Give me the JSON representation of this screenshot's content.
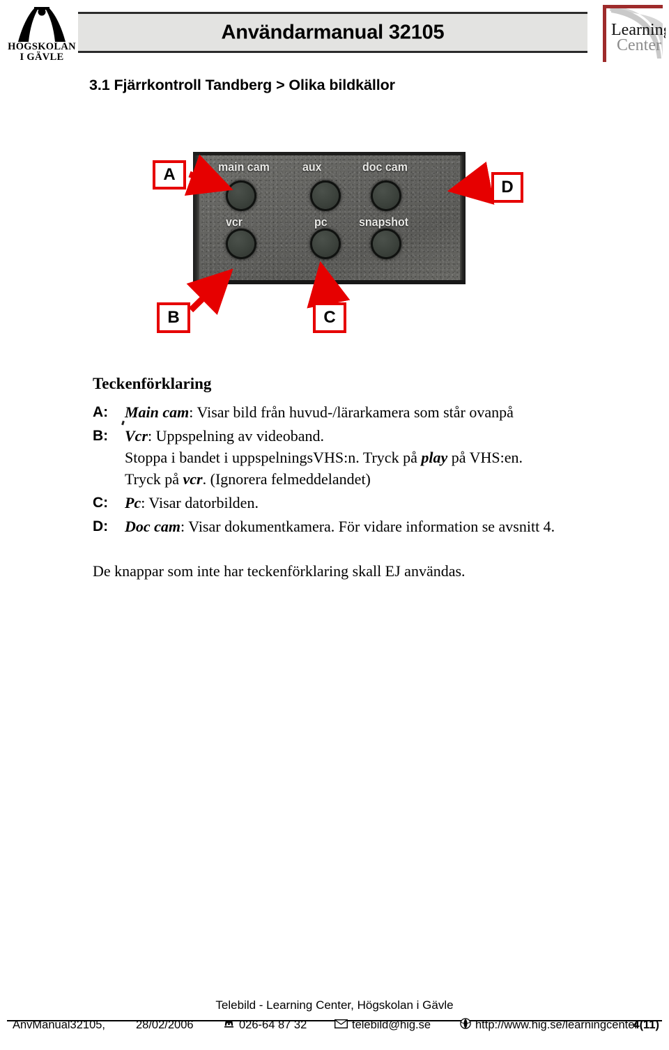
{
  "header": {
    "university_logo_line1": "HÖGSKOLAN",
    "university_logo_line2": "I GÄVLE",
    "title": "Användarmanual 32105",
    "partner_logo_line1": "Learning",
    "partner_logo_line2": "Center",
    "accent_red": "#9e2b2b",
    "bar_background": "#e3e3e1"
  },
  "section": {
    "heading": "3.1 Fjärrkontroll Tandberg > Olika bildkällor"
  },
  "figure": {
    "alt": "Närbild på Tandberg fjärrkontrollens bildkällknappar",
    "callout_color": "#e60000",
    "button_labels": {
      "main_cam": "main cam",
      "aux": "aux",
      "doc_cam": "doc cam",
      "vcr": "vcr",
      "pc": "pc",
      "snapshot": "snapshot"
    },
    "callouts": [
      {
        "id": "A",
        "label": "A",
        "target": "main cam"
      },
      {
        "id": "B",
        "label": "B",
        "target": "vcr"
      },
      {
        "id": "C",
        "label": "C",
        "target": "pc"
      },
      {
        "id": "D",
        "label": "D",
        "target": "doc cam"
      }
    ]
  },
  "legend": {
    "title": "Teckenförklaring",
    "entries": [
      {
        "key": "A:",
        "term": "Main cam",
        "text": ": Visar bild från huvud-/lärarkamera som står ovanpå",
        "extra_lines": []
      },
      {
        "key": "B:",
        "term": "Vcr",
        "text": ": Uppspelning av videoband.",
        "extra_lines": [
          {
            "pre": "Stoppa i bandet i uppspelningsVHS:n. Tryck på ",
            "kw": "play",
            "post": " på VHS:en."
          },
          {
            "pre": "Tryck på ",
            "kw": "vcr",
            "post": ". (Ignorera felmeddelandet)"
          }
        ]
      },
      {
        "key": "C:",
        "term": "Pc",
        "text": ": Visar datorbilden.",
        "extra_lines": []
      },
      {
        "key": "D:",
        "term": "Doc cam",
        "text": ": Visar dokumentkamera. För vidare information se avsnitt 4.",
        "extra_lines": []
      }
    ],
    "closing_note": "De knappar som inte har teckenförklaring skall EJ användas."
  },
  "footer": {
    "organisation": "Telebild - Learning Center, Högskolan i Gävle",
    "document": "AnvManual32105,",
    "date": "28/02/2006",
    "phone": "026-64 87 32",
    "email": "telebild@hig.se",
    "website": "http://www.hig.se/learningcenter",
    "page": "4(11)",
    "phone_icon": "☏",
    "mail_icon": "✉",
    "web_icon": "globe-icon"
  }
}
